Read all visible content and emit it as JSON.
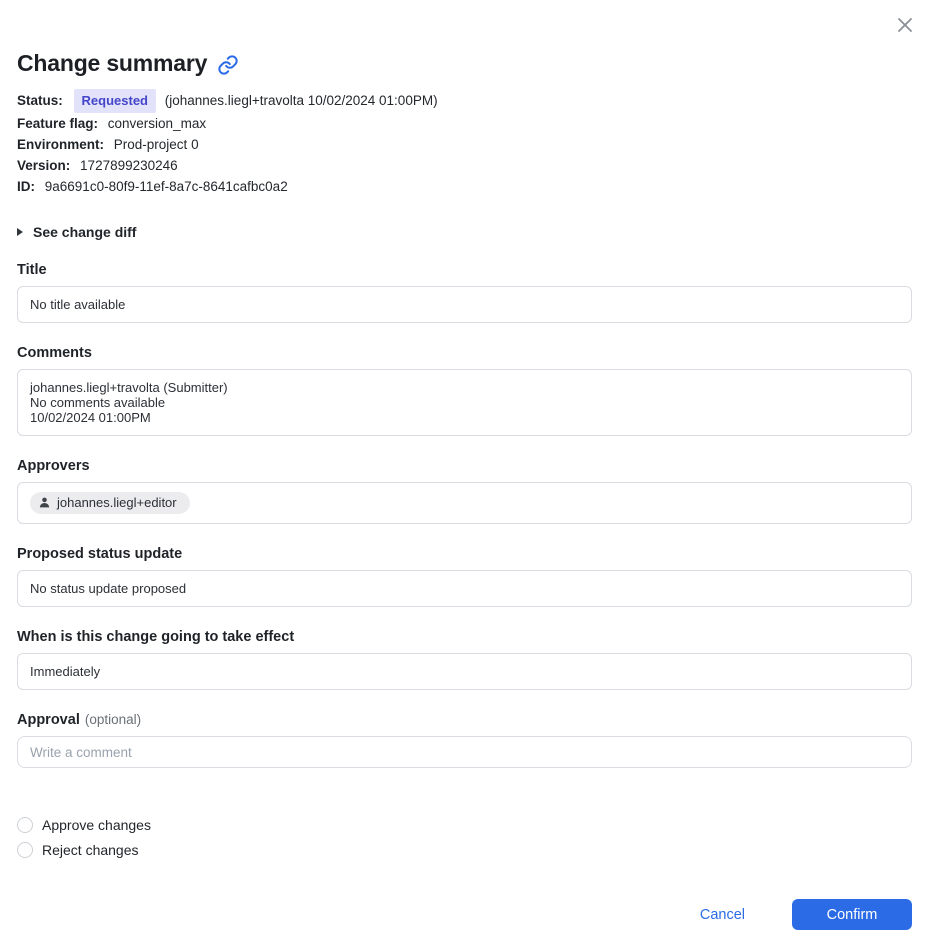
{
  "dialog": {
    "title": "Change summary",
    "meta": {
      "status_label": "Status:",
      "status_badge": "Requested",
      "status_suffix": "(johannes.liegl+travolta 10/02/2024 01:00PM)",
      "rows": [
        {
          "label": "Feature flag:",
          "value": "conversion_max"
        },
        {
          "label": "Environment:",
          "value": "Prod-project 0"
        },
        {
          "label": "Version:",
          "value": "1727899230246"
        },
        {
          "label": "ID:",
          "value": "9a6691c0-80f9-11ef-8a7c-8641cafbc0a2"
        }
      ]
    },
    "disclosure_label": "See change diff",
    "sections": {
      "title": {
        "label": "Title",
        "value": "No title available"
      },
      "comments": {
        "label": "Comments",
        "line1": "johannes.liegl+travolta (Submitter)",
        "line2": "No comments available",
        "line3": "10/02/2024 01:00PM"
      },
      "approvers": {
        "label": "Approvers",
        "chip": "johannes.liegl+editor"
      },
      "proposed_status": {
        "label": "Proposed status update",
        "value": "No status update proposed"
      },
      "effect": {
        "label": "When is this change going to take effect",
        "value": "Immediately"
      },
      "approval": {
        "label": "Approval",
        "optional": "(optional)",
        "placeholder": "Write a comment"
      }
    },
    "radios": [
      {
        "label": "Approve changes"
      },
      {
        "label": "Reject changes"
      }
    ],
    "footer": {
      "cancel_label": "Cancel",
      "confirm_label": "Confirm"
    },
    "colors": {
      "accent_blue": "#2b6ce6",
      "badge_bg": "#e2e2fa",
      "badge_text": "#4545c9"
    }
  }
}
